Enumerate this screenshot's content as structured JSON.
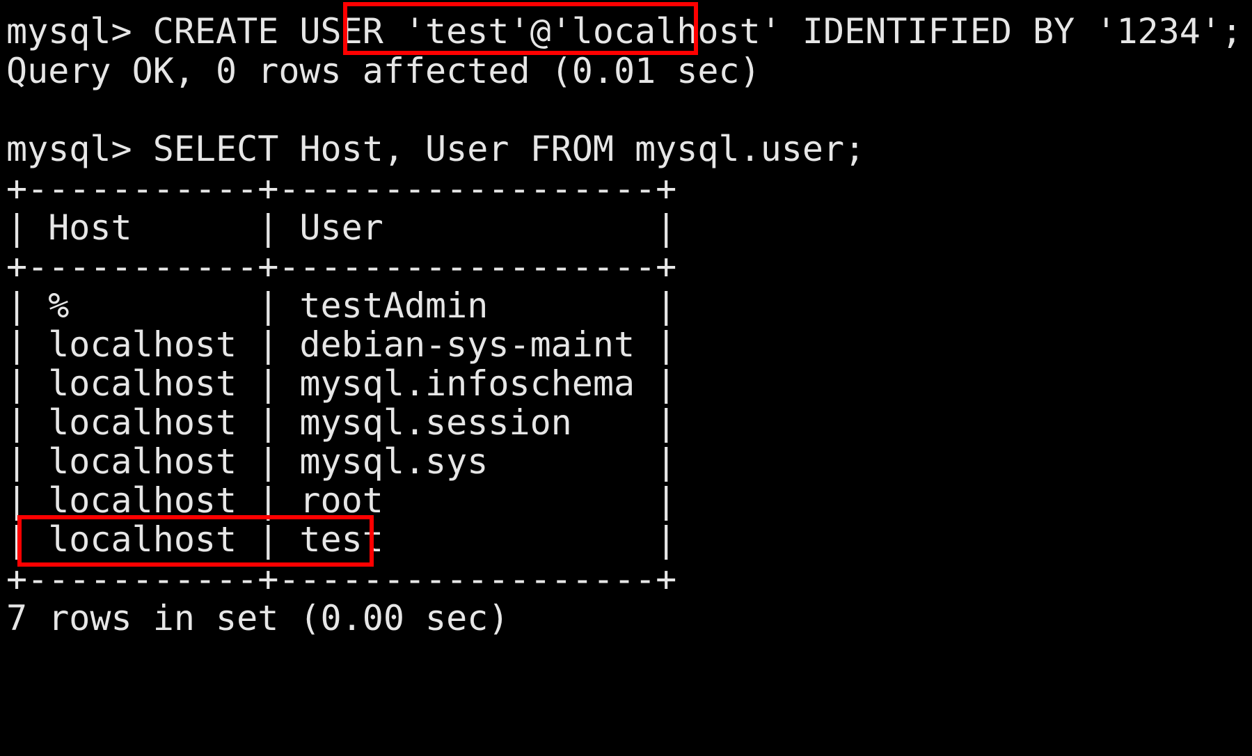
{
  "terminal": {
    "create_prompt": "mysql> ",
    "create_command_before": "CREATE USER ",
    "create_command_highlight": "'test'@'localhost'",
    "create_command_after": " IDENTIFIED BY '1234';",
    "create_result": "Query OK, 0 rows affected (0.01 sec)",
    "select_prompt": "mysql> ",
    "select_command": "SELECT Host, User FROM mysql.user;",
    "table": {
      "border": "+-----------+------------------+",
      "header_line": "| Host      | User             |",
      "columns": [
        "Host",
        "User"
      ],
      "row_lines": [
        "| %         | testAdmin        |",
        "| localhost | debian-sys-maint |",
        "| localhost | mysql.infoschema |",
        "| localhost | mysql.session    |",
        "| localhost | mysql.sys        |",
        "| localhost | root             |",
        "| localhost | test             |"
      ]
    },
    "select_result": "7 rows in set (0.00 sec)"
  },
  "colors": {
    "background": "#000000",
    "text": "#e6e6e6",
    "highlight_box": "#ff0000"
  }
}
